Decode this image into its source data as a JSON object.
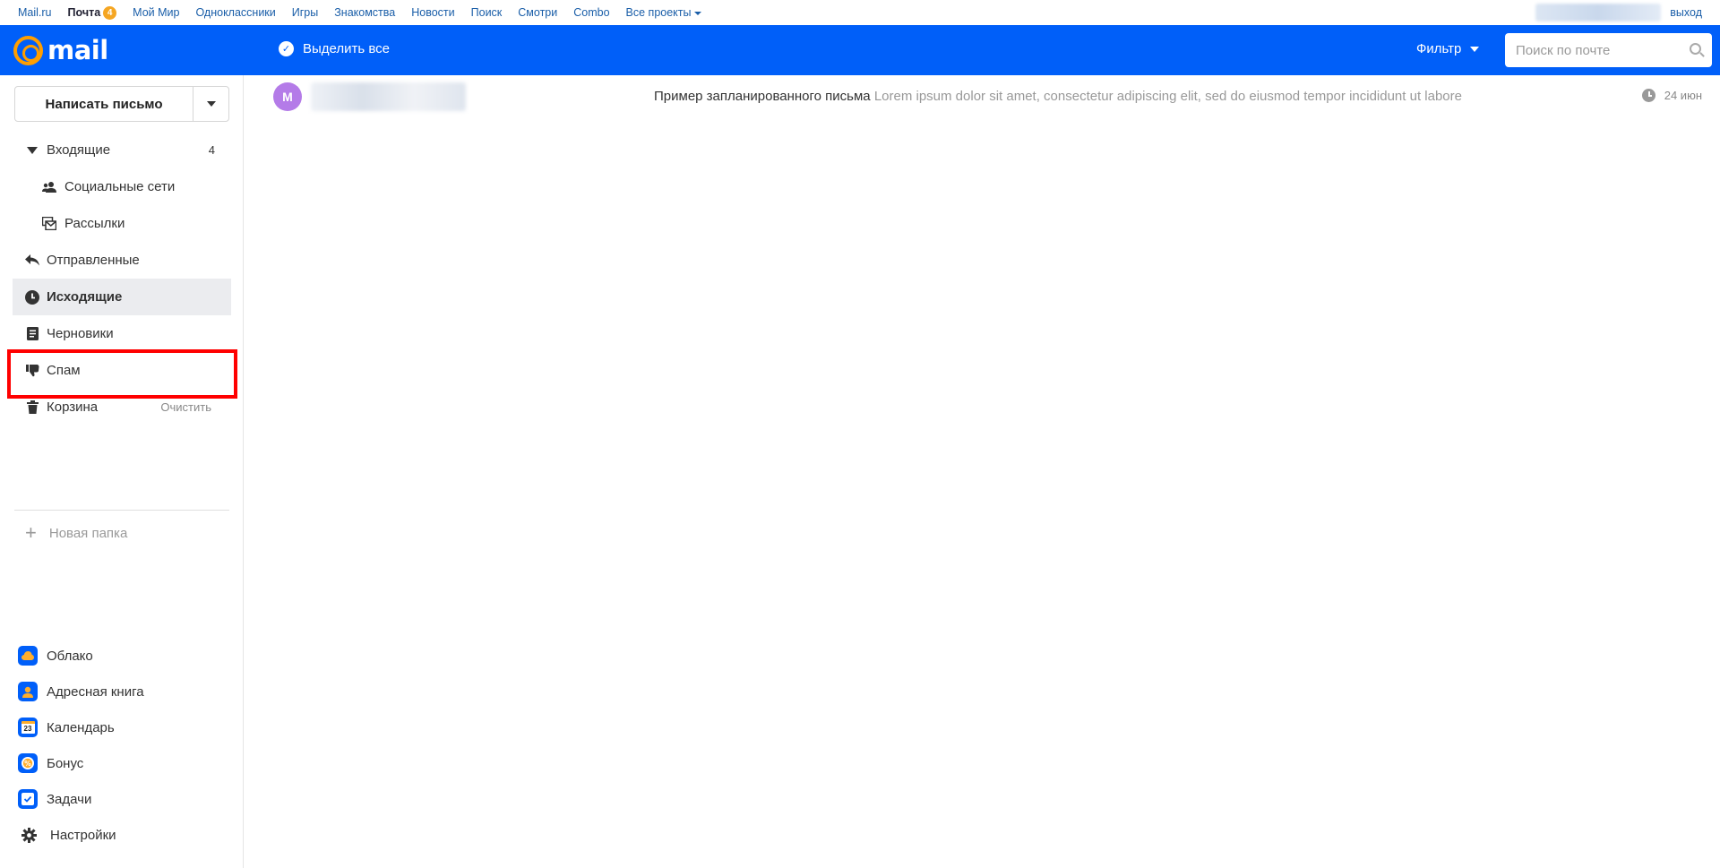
{
  "portal": {
    "links": [
      {
        "label": "Mail.ru"
      },
      {
        "label": "Почта",
        "badge": "4",
        "active": true
      },
      {
        "label": "Мой Мир"
      },
      {
        "label": "Одноклассники"
      },
      {
        "label": "Игры"
      },
      {
        "label": "Знакомства"
      },
      {
        "label": "Новости"
      },
      {
        "label": "Поиск"
      },
      {
        "label": "Смотри"
      },
      {
        "label": "Combo"
      },
      {
        "label": "Все проекты"
      }
    ],
    "logout": "выход"
  },
  "header": {
    "logo_text": "mail",
    "select_all": "Выделить все",
    "filter": "Фильтр",
    "search_placeholder": "Поиск по почте",
    "accent_color": "#005ff9",
    "logo_color": "#ff9e00"
  },
  "sidebar": {
    "compose_label": "Написать письмо",
    "folders": {
      "inbox": {
        "label": "Входящие",
        "count": "4",
        "icon": "triangle-down-icon"
      },
      "social": {
        "label": "Социальные сети",
        "icon": "people-icon"
      },
      "newsletters": {
        "label": "Рассылки",
        "icon": "newsletter-icon"
      },
      "sent": {
        "label": "Отправленные",
        "icon": "reply-arrow-icon"
      },
      "outbox": {
        "label": "Исходящие",
        "icon": "clock-icon",
        "active": true
      },
      "drafts": {
        "label": "Черновики",
        "icon": "document-icon"
      },
      "spam": {
        "label": "Спам",
        "icon": "thumbs-down-icon"
      },
      "trash": {
        "label": "Корзина",
        "action": "Очистить",
        "icon": "trash-icon"
      }
    },
    "new_folder": "Новая папка",
    "apps": {
      "cloud": "Облако",
      "contacts": "Адресная книга",
      "calendar": "Календарь",
      "calendar_day": "23",
      "bonus": "Бонус",
      "tasks": "Задачи",
      "settings": "Настройки"
    }
  },
  "mail_list": [
    {
      "avatar_letter": "M",
      "subject": "Пример запланированного письма",
      "snippet": "Lorem ipsum dolor sit amet, consectetur adipiscing elit, sed do eiusmod tempor incididunt ut labore",
      "date": "24 июн",
      "status_icon": "clock-icon"
    }
  ]
}
